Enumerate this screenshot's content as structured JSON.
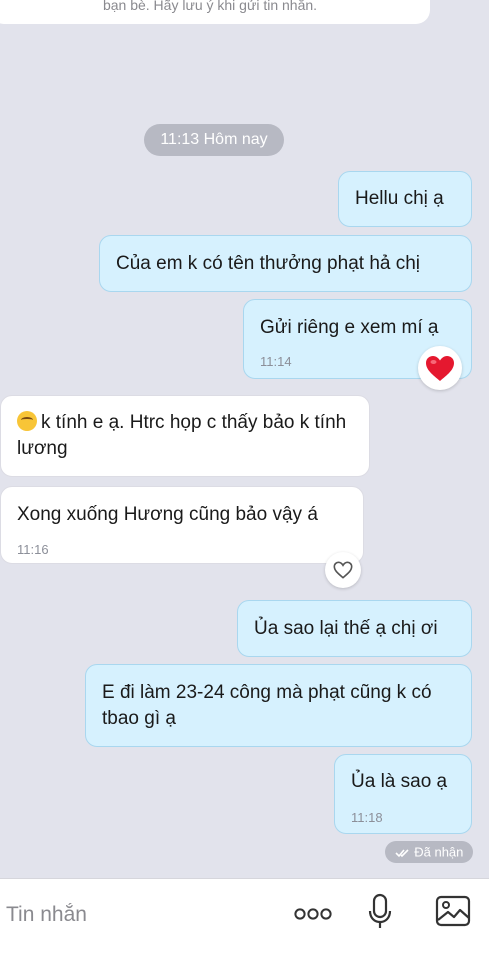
{
  "notice": {
    "text": "bạn bè. Hãy lưu ý khi gửi tin nhắn."
  },
  "time_divider": {
    "label": "11:13 Hôm nay"
  },
  "messages": [
    {
      "dir": "out",
      "text": "Hellu chị ạ"
    },
    {
      "dir": "out",
      "text": "Của em k có tên thưởng phạt hả chị"
    },
    {
      "dir": "out",
      "text": "Gửi riêng e xem mí ạ",
      "time": "11:14",
      "reaction": "heart-emoji"
    },
    {
      "dir": "in",
      "emoji": "crying-face-emoji",
      "text": "k tính e ạ. Htrc họp c thấy bảo k tính lương"
    },
    {
      "dir": "in",
      "text": "Xong xuống Hương cũng bảo vậy á",
      "time": "11:16",
      "reaction": "heart-outline"
    },
    {
      "dir": "out",
      "text": "Ủa sao lại thế ạ chị ơi"
    },
    {
      "dir": "out",
      "text": "E đi làm 23-24 công mà phạt cũng k có tbao gì ạ"
    },
    {
      "dir": "out",
      "text": "Ủa là sao ạ",
      "time": "11:18"
    }
  ],
  "status": {
    "label": "Đã nhận",
    "icon": "double-check-icon"
  },
  "composer": {
    "placeholder": "Tin nhắn",
    "icons": [
      "more-icon",
      "microphone-icon",
      "image-icon"
    ]
  },
  "colors": {
    "background": "#e2e3ec",
    "outgoing_bubble": "#d6f1fe",
    "incoming_bubble": "#ffffff",
    "pill": "#b7b9c3",
    "heart": "#e5182f"
  }
}
